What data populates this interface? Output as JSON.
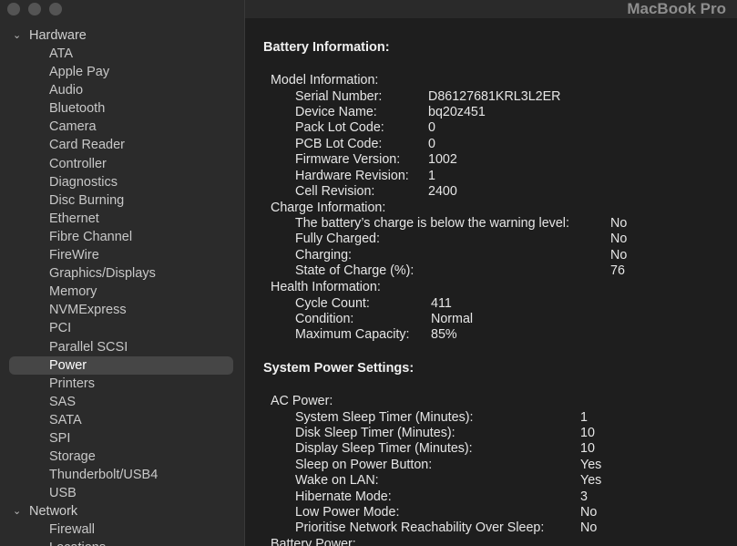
{
  "window": {
    "title": "MacBook Pro"
  },
  "sidebar": {
    "groups": [
      {
        "label": "Hardware",
        "items": [
          "ATA",
          "Apple Pay",
          "Audio",
          "Bluetooth",
          "Camera",
          "Card Reader",
          "Controller",
          "Diagnostics",
          "Disc Burning",
          "Ethernet",
          "Fibre Channel",
          "FireWire",
          "Graphics/Displays",
          "Memory",
          "NVMExpress",
          "PCI",
          "Parallel SCSI",
          "Power",
          "Printers",
          "SAS",
          "SATA",
          "SPI",
          "Storage",
          "Thunderbolt/USB4",
          "USB"
        ],
        "selected": "Power"
      },
      {
        "label": "Network",
        "items": [
          "Firewall",
          "Locations"
        ]
      }
    ]
  },
  "battery": {
    "title": "Battery Information:",
    "model_info": {
      "label": "Model Information:",
      "rows": [
        {
          "k": "Serial Number:",
          "v": "D86127681KRL3L2ER"
        },
        {
          "k": "Device Name:",
          "v": "bq20z451"
        },
        {
          "k": "Pack Lot Code:",
          "v": "0"
        },
        {
          "k": "PCB Lot Code:",
          "v": "0"
        },
        {
          "k": "Firmware Version:",
          "v": "1002"
        },
        {
          "k": "Hardware Revision:",
          "v": "1"
        },
        {
          "k": "Cell Revision:",
          "v": "2400"
        }
      ]
    },
    "charge_info": {
      "label": "Charge Information:",
      "rows": [
        {
          "k": "The battery’s charge is below the warning level:",
          "v": "No"
        },
        {
          "k": "Fully Charged:",
          "v": "No"
        },
        {
          "k": "Charging:",
          "v": "No"
        },
        {
          "k": "State of Charge (%):",
          "v": "76"
        }
      ]
    },
    "health_info": {
      "label": "Health Information:",
      "rows": [
        {
          "k": "Cycle Count:",
          "v": "411"
        },
        {
          "k": "Condition:",
          "v": "Normal"
        },
        {
          "k": "Maximum Capacity:",
          "v": "85%"
        }
      ]
    }
  },
  "power_settings": {
    "title": "System Power Settings:",
    "ac_power": {
      "label": "AC Power:",
      "rows": [
        {
          "k": "System Sleep Timer (Minutes):",
          "v": "1"
        },
        {
          "k": "Disk Sleep Timer (Minutes):",
          "v": "10"
        },
        {
          "k": "Display Sleep Timer (Minutes):",
          "v": "10"
        },
        {
          "k": "Sleep on Power Button:",
          "v": "Yes"
        },
        {
          "k": "Wake on LAN:",
          "v": "Yes"
        },
        {
          "k": "Hibernate Mode:",
          "v": "3"
        },
        {
          "k": "Low Power Mode:",
          "v": "No"
        },
        {
          "k": "Prioritise Network Reachability Over Sleep:",
          "v": "No"
        }
      ]
    },
    "battery_power": {
      "label": "Battery Power:"
    }
  }
}
